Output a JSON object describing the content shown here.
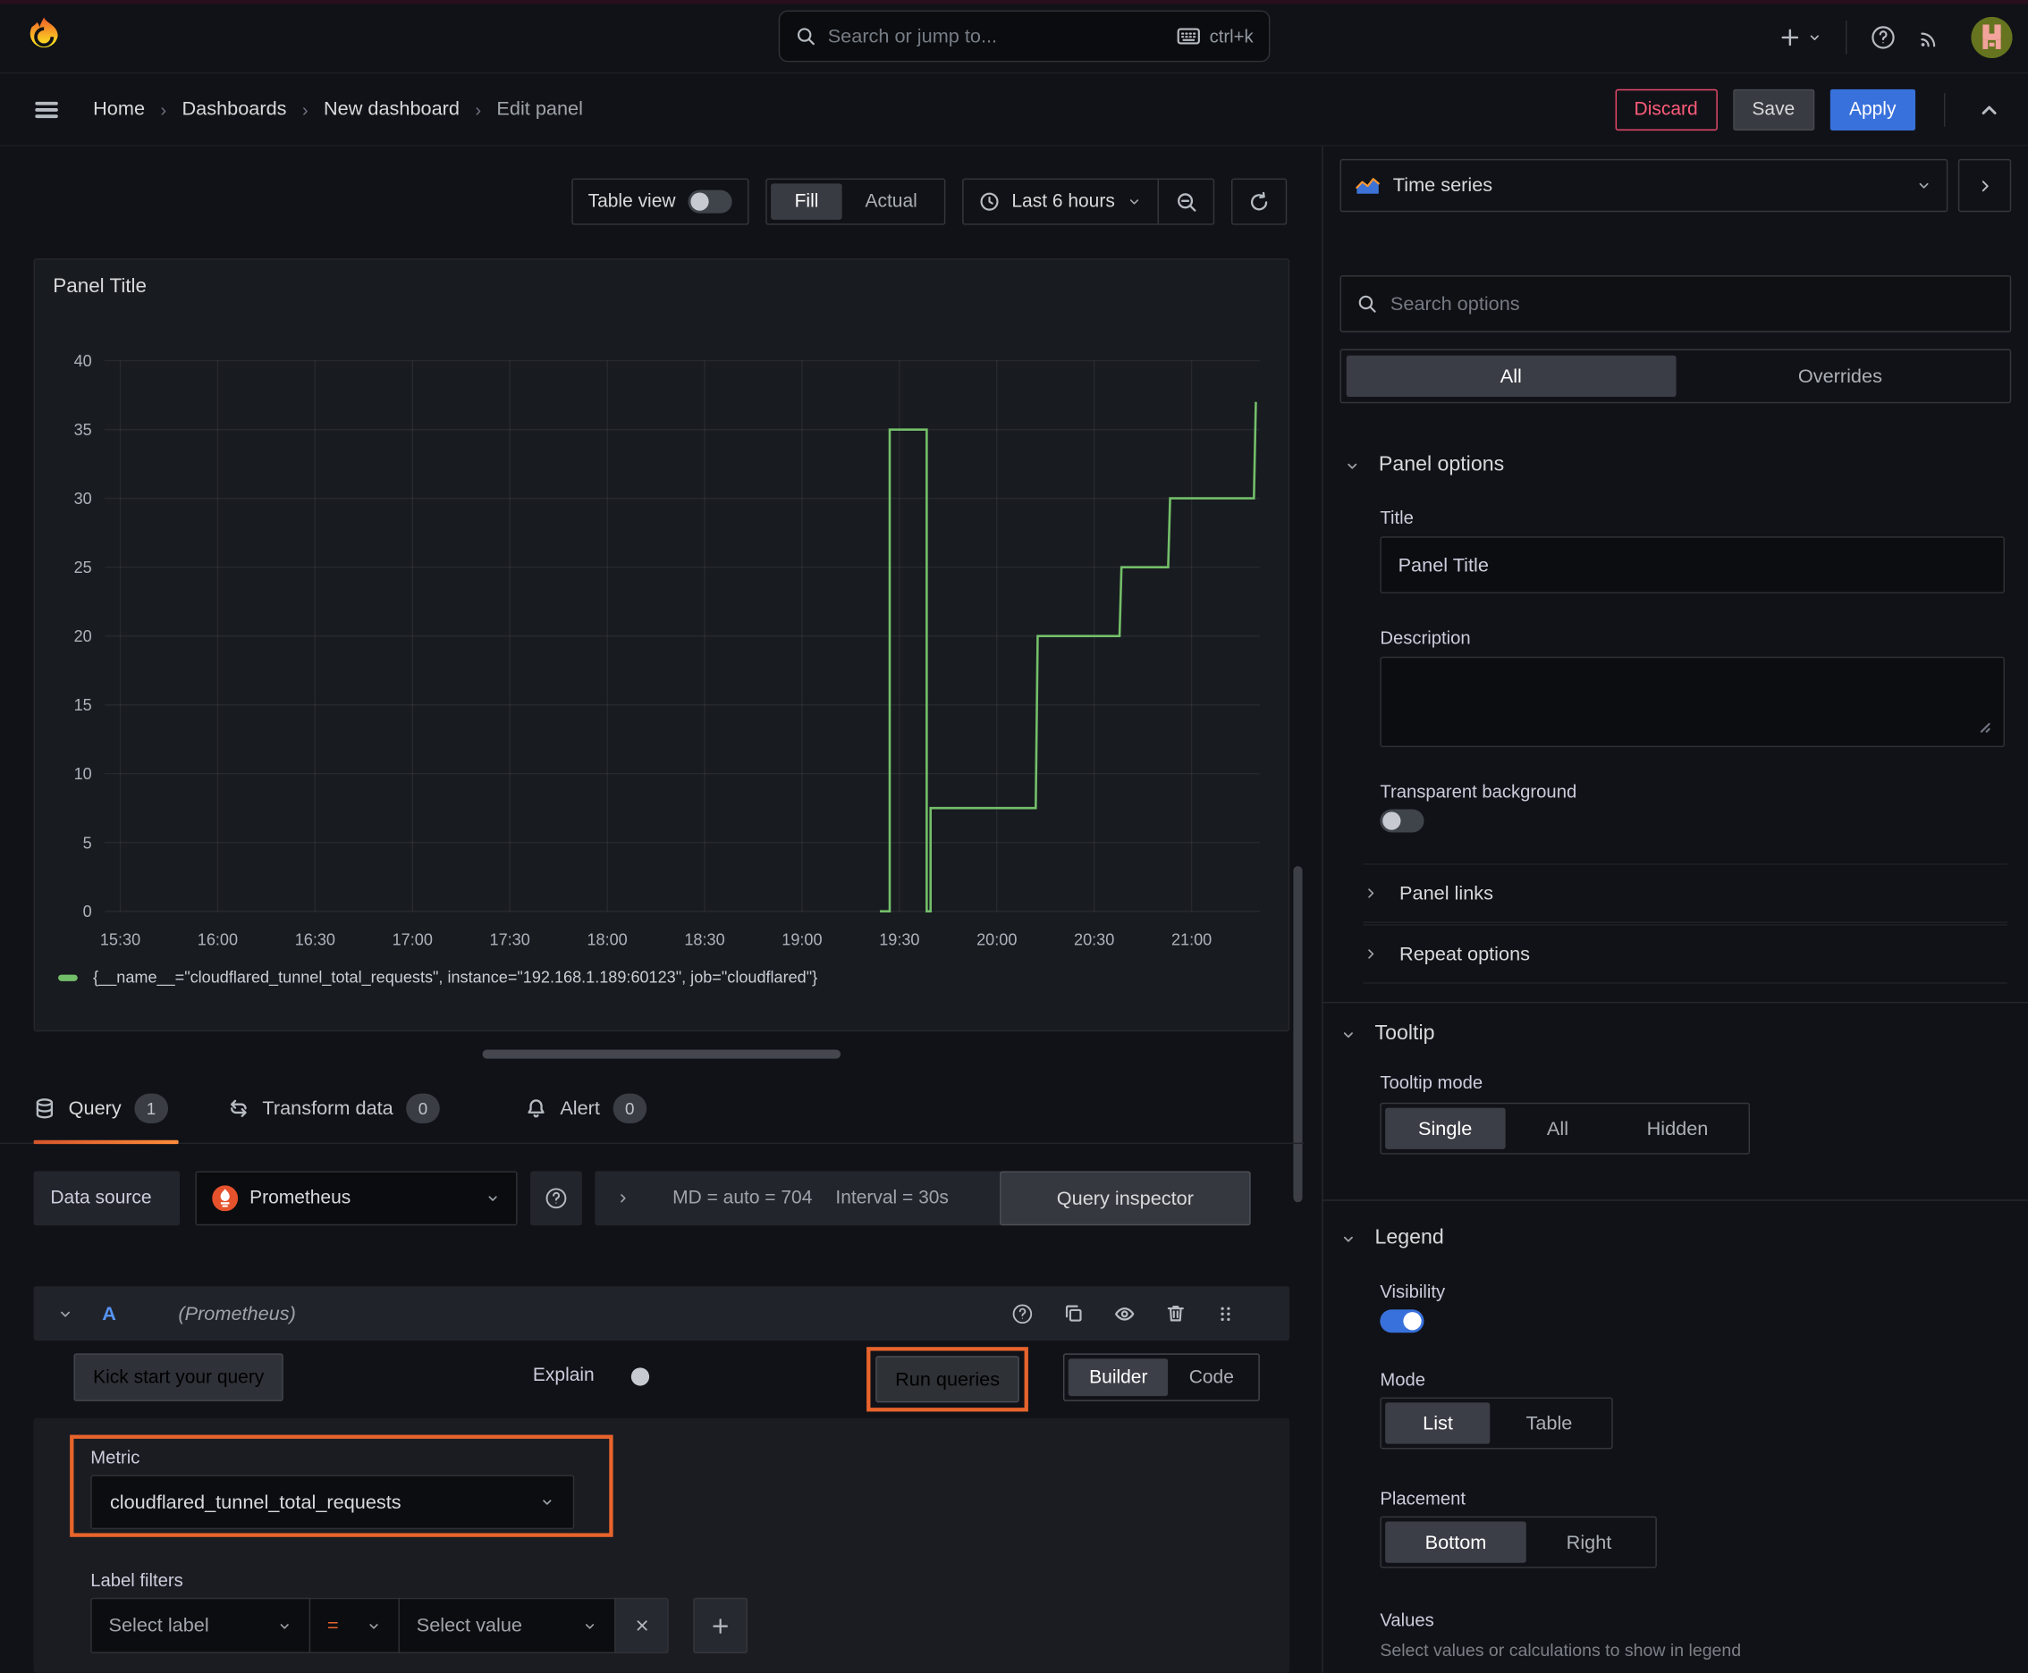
{
  "colors": {
    "accent_orange": "#e8642c",
    "series_green": "#73bf69",
    "primary_blue": "#3871dc",
    "danger_red": "#e84a6c"
  },
  "topbar": {
    "search_placeholder": "Search or jump to...",
    "search_shortcut": "ctrl+k"
  },
  "breadcrumbs": {
    "items": [
      "Home",
      "Dashboards",
      "New dashboard",
      "Edit panel"
    ]
  },
  "header_actions": {
    "discard": "Discard",
    "save": "Save",
    "apply": "Apply"
  },
  "toolbar": {
    "table_view_label": "Table view",
    "fill_label": "Fill",
    "actual_label": "Actual",
    "time_range_label": "Last 6 hours"
  },
  "viz_picker": {
    "name": "Time series",
    "search_placeholder": "Search options",
    "tab_all": "All",
    "tab_overrides": "Overrides"
  },
  "panel": {
    "title": "Panel Title",
    "legend_series": "{__name__=\"cloudflared_tunnel_total_requests\", instance=\"192.168.1.189:60123\", job=\"cloudflared\"}"
  },
  "chart_data": {
    "type": "line",
    "line_style": "step",
    "title": "Panel Title",
    "xlabel": "",
    "ylabel": "",
    "ylim": [
      0,
      40
    ],
    "grid": true,
    "legend_position": "bottom",
    "x_domain_hours": [
      15.42,
      21.35
    ],
    "x_tick_values": [
      15.5,
      16.0,
      16.5,
      17.0,
      17.5,
      18.0,
      18.5,
      19.0,
      19.5,
      20.0,
      20.5,
      21.0
    ],
    "x_tick_labels": [
      "15:30",
      "16:00",
      "16:30",
      "17:00",
      "17:30",
      "18:00",
      "18:30",
      "19:00",
      "19:30",
      "20:00",
      "20:30",
      "21:00"
    ],
    "y_ticks": [
      0,
      5,
      10,
      15,
      20,
      25,
      30,
      35,
      40
    ],
    "series": [
      {
        "name": "{__name__=\"cloudflared_tunnel_total_requests\", instance=\"192.168.1.189:60123\", job=\"cloudflared\"}",
        "color": "#73bf69",
        "points": [
          [
            19.4,
            0
          ],
          [
            19.45,
            0
          ],
          [
            19.45,
            35
          ],
          [
            19.64,
            35
          ],
          [
            19.64,
            0
          ],
          [
            19.66,
            0
          ],
          [
            19.66,
            7.5
          ],
          [
            20.2,
            7.5
          ],
          [
            20.21,
            20
          ],
          [
            20.63,
            20
          ],
          [
            20.64,
            25
          ],
          [
            20.88,
            25
          ],
          [
            20.89,
            30
          ],
          [
            21.32,
            30
          ],
          [
            21.33,
            37
          ]
        ]
      }
    ]
  },
  "query_tabs": {
    "query": "Query",
    "query_count": "1",
    "transform": "Transform data",
    "transform_count": "0",
    "alert": "Alert",
    "alert_count": "0"
  },
  "datasource_bar": {
    "label": "Data source",
    "value": "Prometheus",
    "stat_md": "MD = auto = 704",
    "stat_interval": "Interval = 30s",
    "inspector_label": "Query inspector"
  },
  "query_row": {
    "ref_id": "A",
    "ds_hint": "(Prometheus)",
    "kickstart_label": "Kick start your query",
    "explain_label": "Explain",
    "run_label": "Run queries",
    "builder_label": "Builder",
    "code_label": "Code",
    "metric_label": "Metric",
    "metric_value": "cloudflared_tunnel_total_requests",
    "label_filters_label": "Label filters",
    "select_label_placeholder": "Select label",
    "operator": "=",
    "select_value_placeholder": "Select value"
  },
  "options_pane": {
    "panel_options": {
      "heading": "Panel options",
      "title_label": "Title",
      "title_value": "Panel Title",
      "description_label": "Description",
      "transparent_label": "Transparent background"
    },
    "collapsed": {
      "panel_links": "Panel links",
      "repeat_options": "Repeat options"
    },
    "tooltip": {
      "heading": "Tooltip",
      "mode_label": "Tooltip mode",
      "single": "Single",
      "all": "All",
      "hidden": "Hidden"
    },
    "legend": {
      "heading": "Legend",
      "visibility_label": "Visibility",
      "mode_label": "Mode",
      "list": "List",
      "table": "Table",
      "placement_label": "Placement",
      "bottom": "Bottom",
      "right": "Right",
      "values_label": "Values",
      "values_help": "Select values or calculations to show in legend"
    }
  }
}
